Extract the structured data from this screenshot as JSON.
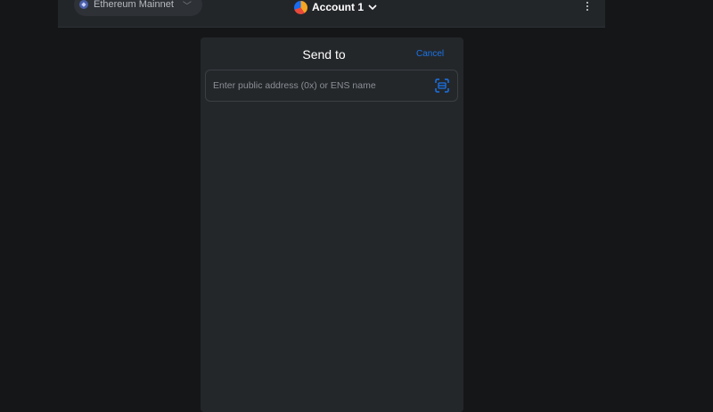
{
  "header": {
    "network_label": "Ethereum Mainnet",
    "account_label": "Account 1"
  },
  "send": {
    "title": "Send to",
    "cancel_label": "Cancel",
    "address_placeholder": "Enter public address (0x) or ENS name",
    "address_value": ""
  },
  "colors": {
    "background": "#141618",
    "panel": "#24272a",
    "topbar": "#232629",
    "accent": "#1a73e8",
    "text_primary": "#ffffff",
    "text_muted": "#8b9096"
  },
  "icons": {
    "network": "ethereum-icon",
    "network_chevron": "chevron-down-icon",
    "account_avatar": "account-avatar-icon",
    "account_chevron": "chevron-down-icon",
    "menu": "kebab-menu-icon",
    "scan": "qr-scan-icon"
  }
}
